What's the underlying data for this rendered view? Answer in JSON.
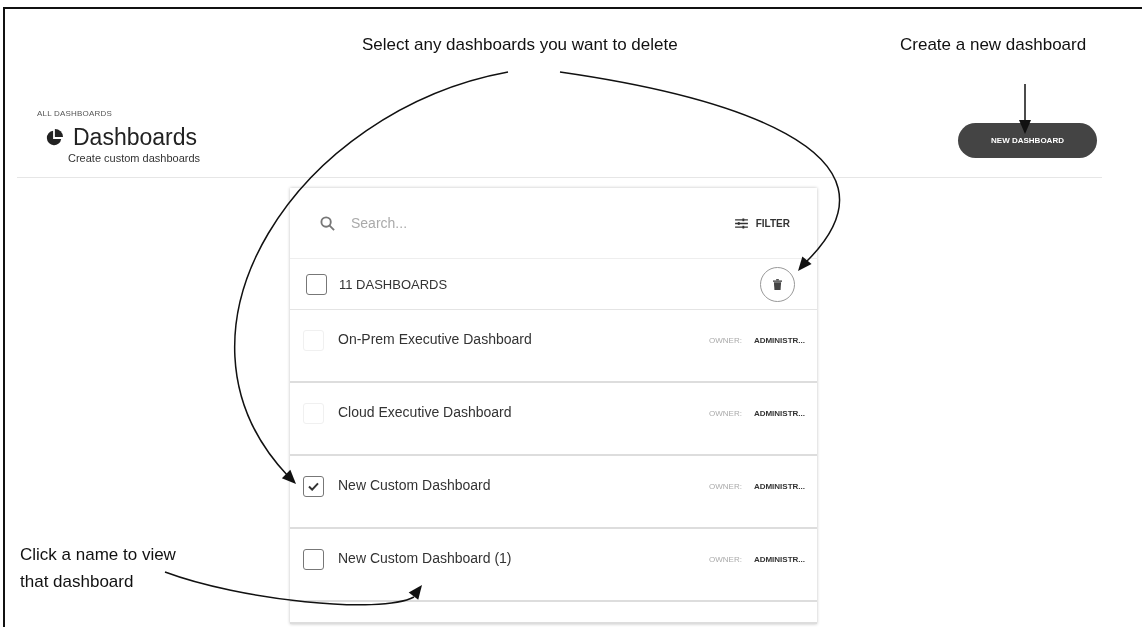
{
  "callouts": {
    "select_to_delete": "Select any dashboards you want to delete",
    "create_new": "Create a new dashboard",
    "click_name": "Click a name to view that dashboard"
  },
  "header": {
    "breadcrumb": "ALL DASHBOARDS",
    "title": "Dashboards",
    "subtitle": "Create custom dashboards",
    "new_button": "NEW DASHBOARD"
  },
  "list": {
    "search": {
      "placeholder": "Search..."
    },
    "filter": "FILTER",
    "count": "11 DASHBOARDS",
    "select_all": {
      "checked": false
    },
    "rows": [
      {
        "name": "On-Prem Executive Dashboard",
        "owner_label": "OWNER:",
        "owner": "ADMINISTR...",
        "checked": false,
        "disabled": true
      },
      {
        "name": "Cloud Executive Dashboard",
        "owner_label": "OWNER:",
        "owner": "ADMINISTR...",
        "checked": false,
        "disabled": true
      },
      {
        "name": "New Custom Dashboard",
        "owner_label": "OWNER:",
        "owner": "ADMINISTR...",
        "checked": true,
        "disabled": false
      },
      {
        "name": "New Custom Dashboard (1)",
        "owner_label": "OWNER:",
        "owner": "ADMINISTR...",
        "checked": false,
        "disabled": false
      }
    ]
  }
}
